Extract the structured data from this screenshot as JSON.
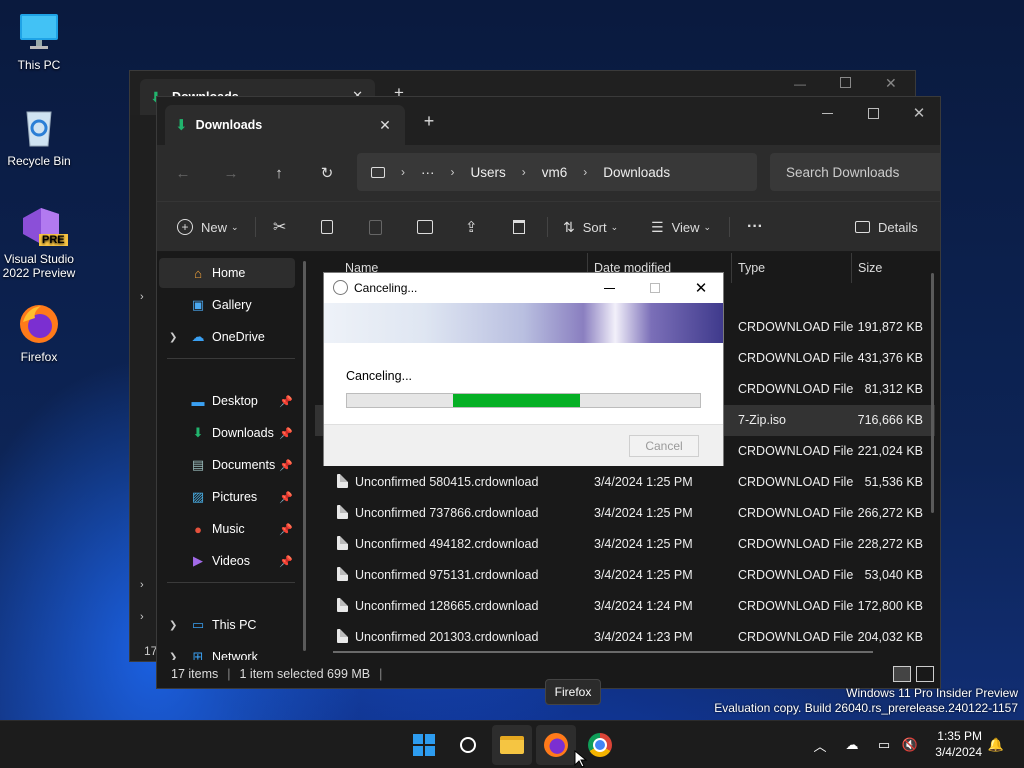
{
  "desktop": {
    "icons": [
      {
        "label": "This PC"
      },
      {
        "label": "Recycle Bin"
      },
      {
        "label": "Visual Studio 2022 Preview",
        "badge": "PRE"
      },
      {
        "label": "Firefox"
      }
    ]
  },
  "window": {
    "tab_title": "Downloads",
    "tab_close": "✕",
    "new_tab": "+",
    "breadcrumb": [
      "Users",
      "vm6",
      "Downloads"
    ],
    "breadcrumb_more": "···",
    "search_placeholder": "Search Downloads",
    "commands": {
      "new": "New",
      "sort": "Sort",
      "view": "View",
      "more": "···",
      "details": "Details"
    },
    "sidebar": {
      "home": "Home",
      "gallery": "Gallery",
      "onedrive": "OneDrive",
      "desktop": "Desktop",
      "downloads": "Downloads",
      "documents": "Documents",
      "pictures": "Pictures",
      "music": "Music",
      "videos": "Videos",
      "thispc": "This PC",
      "network": "Network"
    },
    "columns": {
      "name": "Name",
      "date": "Date modified",
      "type": "Type",
      "size": "Size"
    },
    "rows": [
      {
        "name": "",
        "date": "",
        "type": "CRDOWNLOAD File",
        "size": "191,872 KB"
      },
      {
        "name": "",
        "date": "",
        "type": "CRDOWNLOAD File",
        "size": "431,376 KB"
      },
      {
        "name": "",
        "date": "",
        "type": "CRDOWNLOAD File",
        "size": "81,312 KB"
      },
      {
        "name": "",
        "date": "",
        "type": "7-Zip.iso",
        "size": "716,666 KB"
      },
      {
        "name": "",
        "date": "",
        "type": "CRDOWNLOAD File",
        "size": "221,024 KB"
      },
      {
        "name": "Unconfirmed 580415.crdownload",
        "date": "3/4/2024 1:25 PM",
        "type": "CRDOWNLOAD File",
        "size": "51,536 KB"
      },
      {
        "name": "Unconfirmed 737866.crdownload",
        "date": "3/4/2024 1:25 PM",
        "type": "CRDOWNLOAD File",
        "size": "266,272 KB"
      },
      {
        "name": "Unconfirmed 494182.crdownload",
        "date": "3/4/2024 1:25 PM",
        "type": "CRDOWNLOAD File",
        "size": "228,272 KB"
      },
      {
        "name": "Unconfirmed 975131.crdownload",
        "date": "3/4/2024 1:25 PM",
        "type": "CRDOWNLOAD File",
        "size": "53,040 KB"
      },
      {
        "name": "Unconfirmed 128665.crdownload",
        "date": "3/4/2024 1:24 PM",
        "type": "CRDOWNLOAD File",
        "size": "172,800 KB"
      },
      {
        "name": "Unconfirmed 201303.crdownload",
        "date": "3/4/2024 1:23 PM",
        "type": "CRDOWNLOAD File",
        "size": "204,032 KB"
      }
    ],
    "status": {
      "items": "17 items",
      "selected": "1 item selected  699 MB"
    }
  },
  "back_window": {
    "tab_title": "Downloads",
    "status_count": "17"
  },
  "dialog": {
    "title": "Canceling...",
    "message": "Canceling...",
    "progress_start": 0.3,
    "progress_end": 0.66,
    "cancel_label": "Cancel"
  },
  "taskbar": {
    "tooltip": "Firefox",
    "time": "1:35 PM",
    "date": "3/4/2024"
  },
  "watermark": {
    "line1": "Windows 11 Pro Insider Preview",
    "line2": "Evaluation copy. Build 26040.rs_prerelease.240122-1157"
  },
  "colors": {
    "accent_green": "#06b025",
    "window_bg": "#191919",
    "download_icon": "#21b46d"
  }
}
